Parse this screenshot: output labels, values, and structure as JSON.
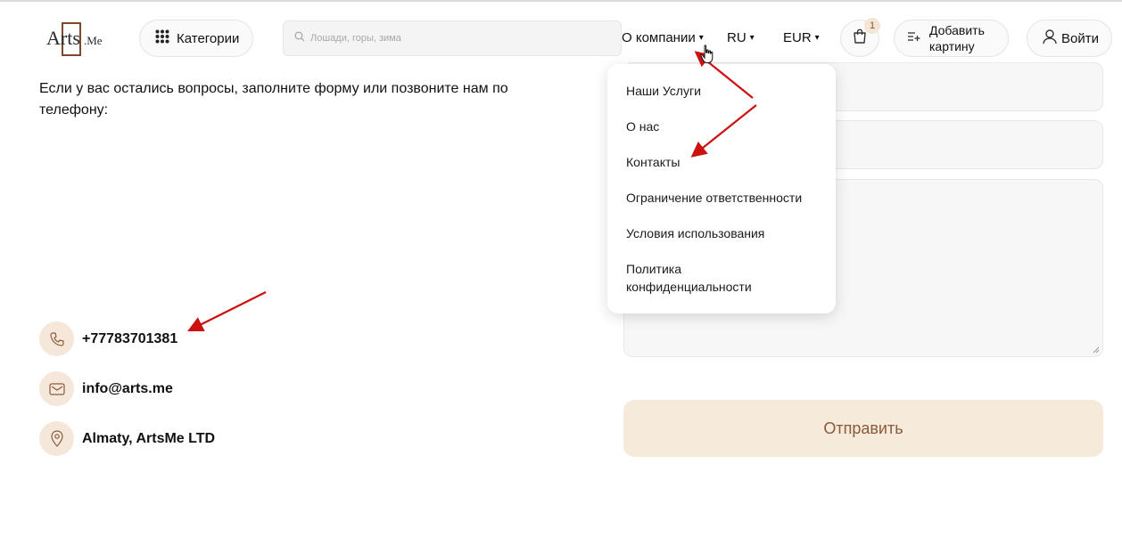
{
  "header": {
    "logo_text": "Arts",
    "logo_suffix": ".Me",
    "categories_label": "Категории",
    "search_placeholder": "Лошади, горы, зима",
    "nav_company": "О компании",
    "nav_language": "RU",
    "nav_currency": "EUR",
    "caret": "▾",
    "cart_count": "1",
    "add_painting_label": "Добавить картину",
    "login_label": "Войти"
  },
  "intro_text": "Если у вас остались вопросы, заполните форму или позвоните нам по телефону:",
  "contacts": {
    "phone": "+77783701381",
    "email": "info@arts.me",
    "address": "Almaty, ArtsMe LTD"
  },
  "form": {
    "submit_label": "Отправить"
  },
  "dropdown": {
    "items": [
      "Наши Услуги",
      "О нас",
      "Контакты",
      "Ограничение ответственности",
      "Условия использования",
      "Политика конфиденциальности"
    ]
  },
  "colors": {
    "accent_bg": "#f6eadb",
    "accent_text": "#8a5a3c",
    "annotation_arrow": "#cc1111"
  }
}
